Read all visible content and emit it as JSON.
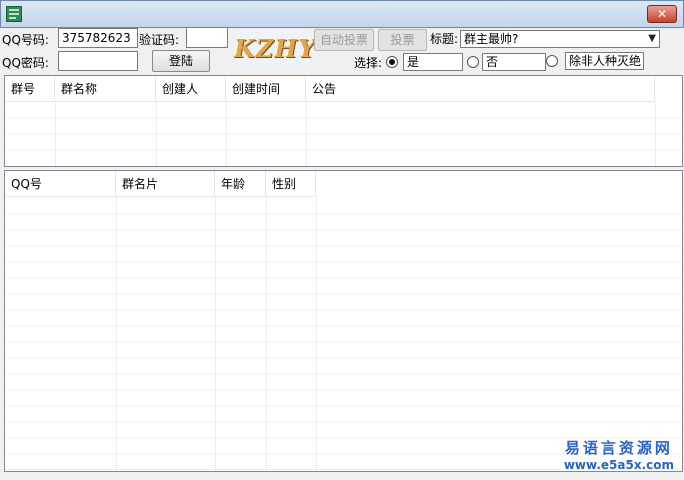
{
  "window": {
    "close_label": "✕"
  },
  "login": {
    "qq_label": "QQ号码:",
    "qq_value": "375782623",
    "password_label": "QQ密码:",
    "password_value": "",
    "captcha_label": "验证码:",
    "captcha_value": "",
    "login_button": "登陆"
  },
  "logo_text": "KZHY",
  "vote": {
    "auto_vote_button": "自动投票",
    "vote_button": "投票",
    "title_label": "标题:",
    "title_value": "群主最帅?",
    "choice_label": "选择:",
    "options": [
      {
        "text": "是",
        "checked": true
      },
      {
        "text": "否",
        "checked": false
      },
      {
        "text": "除非人种灭绝",
        "checked": false
      }
    ]
  },
  "group_list": {
    "columns": [
      "群号",
      "群名称",
      "创建人",
      "创建时间",
      "公告"
    ],
    "rows": []
  },
  "member_list": {
    "columns": [
      "QQ号",
      "群名片",
      "年龄",
      "性别"
    ],
    "rows": []
  },
  "watermark": {
    "title": "易语言资源网",
    "url": "www.e5a5x.com"
  }
}
